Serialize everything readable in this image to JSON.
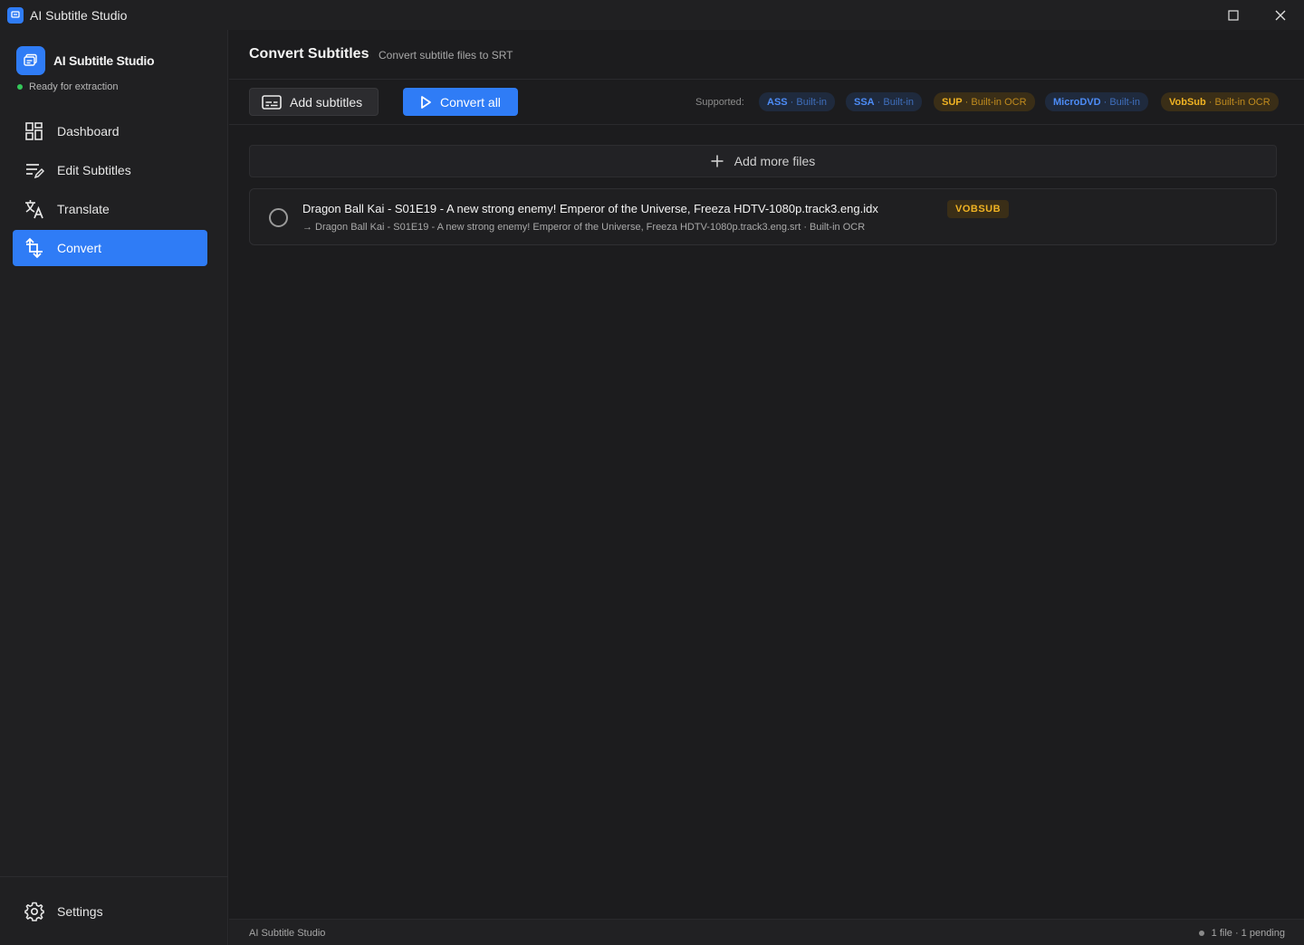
{
  "window": {
    "title": "AI Subtitle Studio"
  },
  "sidebar": {
    "brand_name": "AI Subtitle Studio",
    "status_text": "Ready for extraction",
    "status_color": "#34c759",
    "items": [
      {
        "label": "Dashboard",
        "icon": "dashboard-icon",
        "active": false
      },
      {
        "label": "Edit Subtitles",
        "icon": "edit-subtitles-icon",
        "active": false
      },
      {
        "label": "Translate",
        "icon": "translate-icon",
        "active": false
      },
      {
        "label": "Convert",
        "icon": "convert-icon",
        "active": true
      }
    ],
    "settings_label": "Settings"
  },
  "header": {
    "title": "Convert Subtitles",
    "subtitle": "Convert subtitle files to SRT"
  },
  "toolbar": {
    "add_label": "Add subtitles",
    "convert_label": "Convert all",
    "supported_label": "Supported:",
    "formats": [
      {
        "format": "ASS",
        "method": "Built-in",
        "color": "blue"
      },
      {
        "format": "SSA",
        "method": "Built-in",
        "color": "blue"
      },
      {
        "format": "SUP",
        "method": "Built-in OCR",
        "color": "amber"
      },
      {
        "format": "MicroDVD",
        "method": "Built-in",
        "color": "blue"
      },
      {
        "format": "VobSub",
        "method": "Built-in OCR",
        "color": "amber"
      }
    ]
  },
  "add_more_label": "Add more files",
  "files": [
    {
      "name": "Dragon Ball Kai - S01E19 - A new strong enemy! Emperor of the Universe, Freeza HDTV-1080p.track3.eng.idx",
      "badge": "VOBSUB",
      "output": "→ Dragon Ball Kai - S01E19 - A new strong enemy! Emperor of the Universe, Freeza HDTV-1080p.track3.eng.srt · Built-in OCR"
    }
  ],
  "footer": {
    "left": "AI Subtitle Studio",
    "right": "1 file · 1 pending"
  },
  "colors": {
    "accent": "#2f7cf6",
    "amber": "#f0b323",
    "background": "#1c1c1e",
    "sidebar": "#202022"
  }
}
